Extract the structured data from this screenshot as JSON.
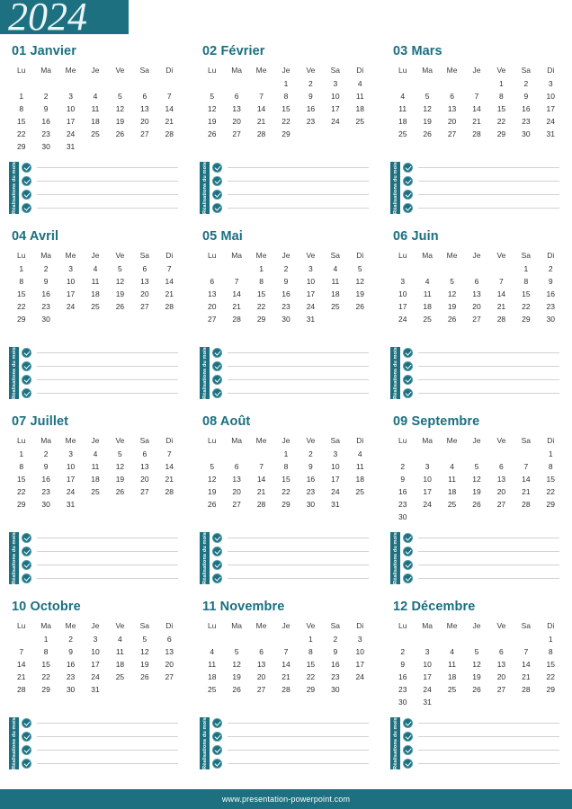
{
  "header": {
    "year": "2024",
    "accent_color": "#1d7080",
    "title_color": "#1a6f80"
  },
  "weekday_headers": [
    "Lu",
    "Ma",
    "Me",
    "Je",
    "Ve",
    "Sa",
    "Di"
  ],
  "notes": {
    "tab_label": "Réalisations du mois",
    "line_count": 4,
    "icon": "check-circle-icon"
  },
  "footer": {
    "url": "www.presentation-powerpoint.com"
  },
  "months": [
    {
      "number": "01",
      "name": "Janvier",
      "title": "01 Janvier",
      "lead_blanks": 0,
      "days": 31,
      "weeks": [
        [
          "",
          "",
          "",
          "",
          "",
          "",
          ""
        ],
        [
          "1",
          "2",
          "3",
          "4",
          "5",
          "6",
          "7"
        ],
        [
          "8",
          "9",
          "10",
          "11",
          "12",
          "13",
          "14"
        ],
        [
          "15",
          "16",
          "17",
          "18",
          "19",
          "20",
          "21"
        ],
        [
          "22",
          "23",
          "24",
          "25",
          "26",
          "27",
          "28"
        ],
        [
          "29",
          "30",
          "31",
          "",
          "",
          "",
          ""
        ]
      ]
    },
    {
      "number": "02",
      "name": "Février",
      "title": "02 Février",
      "lead_blanks": 3,
      "days": 29,
      "weeks": [
        [
          "",
          "",
          "",
          "1",
          "2",
          "3",
          "4"
        ],
        [
          "5",
          "6",
          "7",
          "8",
          "9",
          "10",
          "11"
        ],
        [
          "12",
          "13",
          "14",
          "15",
          "16",
          "17",
          "18"
        ],
        [
          "19",
          "20",
          "21",
          "22",
          "23",
          "24",
          "25"
        ],
        [
          "26",
          "27",
          "28",
          "29",
          "",
          "",
          ""
        ],
        [
          "",
          "",
          "",
          "",
          "",
          "",
          ""
        ]
      ]
    },
    {
      "number": "03",
      "name": "Mars",
      "title": "03 Mars",
      "lead_blanks": 4,
      "days": 31,
      "weeks": [
        [
          "",
          "",
          "",
          "",
          "1",
          "2",
          "3"
        ],
        [
          "4",
          "5",
          "6",
          "7",
          "8",
          "9",
          "10"
        ],
        [
          "11",
          "12",
          "13",
          "14",
          "15",
          "16",
          "17"
        ],
        [
          "18",
          "19",
          "20",
          "21",
          "22",
          "23",
          "24"
        ],
        [
          "25",
          "26",
          "27",
          "28",
          "29",
          "30",
          "31"
        ],
        [
          "",
          "",
          "",
          "",
          "",
          "",
          ""
        ]
      ]
    },
    {
      "number": "04",
      "name": "Avril",
      "title": "04 Avril",
      "lead_blanks": 0,
      "days": 30,
      "weeks": [
        [
          "1",
          "2",
          "3",
          "4",
          "5",
          "6",
          "7"
        ],
        [
          "8",
          "9",
          "10",
          "11",
          "12",
          "13",
          "14"
        ],
        [
          "15",
          "16",
          "17",
          "18",
          "19",
          "20",
          "21"
        ],
        [
          "22",
          "23",
          "24",
          "25",
          "26",
          "27",
          "28"
        ],
        [
          "29",
          "30",
          "",
          "",
          "",
          "",
          ""
        ],
        [
          "",
          "",
          "",
          "",
          "",
          "",
          ""
        ]
      ]
    },
    {
      "number": "05",
      "name": "Mai",
      "title": "05 Mai",
      "lead_blanks": 2,
      "days": 31,
      "weeks": [
        [
          "",
          "",
          "1",
          "2",
          "3",
          "4",
          "5"
        ],
        [
          "6",
          "7",
          "8",
          "9",
          "10",
          "11",
          "12"
        ],
        [
          "13",
          "14",
          "15",
          "16",
          "17",
          "18",
          "19"
        ],
        [
          "20",
          "21",
          "22",
          "23",
          "24",
          "25",
          "26"
        ],
        [
          "27",
          "28",
          "29",
          "30",
          "31",
          "",
          ""
        ],
        [
          "",
          "",
          "",
          "",
          "",
          "",
          ""
        ]
      ]
    },
    {
      "number": "06",
      "name": "Juin",
      "title": "06 Juin",
      "lead_blanks": 5,
      "days": 30,
      "weeks": [
        [
          "",
          "",
          "",
          "",
          "",
          "1",
          "2"
        ],
        [
          "3",
          "4",
          "5",
          "6",
          "7",
          "8",
          "9"
        ],
        [
          "10",
          "11",
          "12",
          "13",
          "14",
          "15",
          "16"
        ],
        [
          "17",
          "18",
          "19",
          "20",
          "21",
          "22",
          "23"
        ],
        [
          "24",
          "25",
          "26",
          "27",
          "28",
          "29",
          "30"
        ],
        [
          "",
          "",
          "",
          "",
          "",
          "",
          ""
        ]
      ]
    },
    {
      "number": "07",
      "name": "Juillet",
      "title": "07 Juillet",
      "lead_blanks": 0,
      "days": 31,
      "weeks": [
        [
          "1",
          "2",
          "3",
          "4",
          "5",
          "6",
          "7"
        ],
        [
          "8",
          "9",
          "10",
          "11",
          "12",
          "13",
          "14"
        ],
        [
          "15",
          "16",
          "17",
          "18",
          "19",
          "20",
          "21"
        ],
        [
          "22",
          "23",
          "24",
          "25",
          "26",
          "27",
          "28"
        ],
        [
          "29",
          "30",
          "31",
          "",
          "",
          "",
          ""
        ],
        [
          "",
          "",
          "",
          "",
          "",
          "",
          ""
        ]
      ]
    },
    {
      "number": "08",
      "name": "Août",
      "title": "08 Août",
      "lead_blanks": 3,
      "days": 31,
      "weeks": [
        [
          "",
          "",
          "",
          "1",
          "2",
          "3",
          "4"
        ],
        [
          "5",
          "6",
          "7",
          "8",
          "9",
          "10",
          "11"
        ],
        [
          "12",
          "13",
          "14",
          "15",
          "16",
          "17",
          "18"
        ],
        [
          "19",
          "20",
          "21",
          "22",
          "23",
          "24",
          "25"
        ],
        [
          "26",
          "27",
          "28",
          "29",
          "30",
          "31",
          ""
        ],
        [
          "",
          "",
          "",
          "",
          "",
          "",
          ""
        ]
      ]
    },
    {
      "number": "09",
      "name": "Septembre",
      "title": "09 Septembre",
      "lead_blanks": 6,
      "days": 30,
      "weeks": [
        [
          "",
          "",
          "",
          "",
          "",
          "",
          "1"
        ],
        [
          "2",
          "3",
          "4",
          "5",
          "6",
          "7",
          "8"
        ],
        [
          "9",
          "10",
          "11",
          "12",
          "13",
          "14",
          "15"
        ],
        [
          "16",
          "17",
          "18",
          "19",
          "20",
          "21",
          "22"
        ],
        [
          "23",
          "24",
          "25",
          "26",
          "27",
          "28",
          "29"
        ],
        [
          "30",
          "",
          "",
          "",
          "",
          "",
          ""
        ]
      ]
    },
    {
      "number": "10",
      "name": "Octobre",
      "title": "10 Octobre",
      "lead_blanks": 1,
      "days": 31,
      "weeks": [
        [
          "",
          "1",
          "2",
          "3",
          "4",
          "5",
          "6"
        ],
        [
          "7",
          "8",
          "9",
          "10",
          "11",
          "12",
          "13"
        ],
        [
          "14",
          "15",
          "16",
          "17",
          "18",
          "19",
          "20"
        ],
        [
          "21",
          "22",
          "23",
          "24",
          "25",
          "26",
          "27"
        ],
        [
          "28",
          "29",
          "30",
          "31",
          "",
          "",
          ""
        ],
        [
          "",
          "",
          "",
          "",
          "",
          "",
          ""
        ]
      ]
    },
    {
      "number": "11",
      "name": "Novembre",
      "title": "11 Novembre",
      "lead_blanks": 4,
      "days": 30,
      "weeks": [
        [
          "",
          "",
          "",
          "",
          "1",
          "2",
          "3"
        ],
        [
          "4",
          "5",
          "6",
          "7",
          "8",
          "9",
          "10"
        ],
        [
          "11",
          "12",
          "13",
          "14",
          "15",
          "16",
          "17"
        ],
        [
          "18",
          "19",
          "20",
          "21",
          "22",
          "23",
          "24"
        ],
        [
          "25",
          "26",
          "27",
          "28",
          "29",
          "30",
          ""
        ],
        [
          "",
          "",
          "",
          "",
          "",
          "",
          ""
        ]
      ]
    },
    {
      "number": "12",
      "name": "Décembre",
      "title": "12 Décembre",
      "lead_blanks": 6,
      "days": 31,
      "weeks": [
        [
          "",
          "",
          "",
          "",
          "",
          "",
          "1"
        ],
        [
          "2",
          "3",
          "4",
          "5",
          "6",
          "7",
          "8"
        ],
        [
          "9",
          "10",
          "11",
          "12",
          "13",
          "14",
          "15"
        ],
        [
          "16",
          "17",
          "18",
          "19",
          "20",
          "21",
          "22"
        ],
        [
          "23",
          "24",
          "25",
          "26",
          "27",
          "28",
          "29"
        ],
        [
          "30",
          "31",
          "",
          "",
          "",
          "",
          ""
        ]
      ]
    }
  ]
}
